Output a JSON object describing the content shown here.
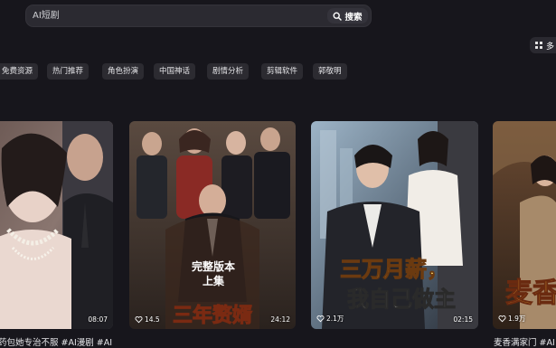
{
  "search": {
    "value": "AI短剧",
    "button_label": "搜索"
  },
  "top_right": {
    "label": "多"
  },
  "tags": [
    "免费资源",
    "热门推荐",
    "角色扮演",
    "中国神话",
    "剧情分析",
    "剪辑软件",
    "郭敬明"
  ],
  "cards": [
    {
      "duration": "08:07",
      "likes": "",
      "caption": "药包她专治不服 #AI漫剧 #AI",
      "overlay_title": ""
    },
    {
      "duration": "24:12",
      "likes": "14.5",
      "caption": "",
      "overlay_badge": "完整版本\n上集",
      "overlay_title": "三年赘婿"
    },
    {
      "duration": "02:15",
      "likes": "2.1万",
      "caption": "",
      "overlay_title": "三万月薪，\n我自己做主"
    },
    {
      "duration": "",
      "likes": "1.9万",
      "caption": "麦香满家门 #AI",
      "overlay_title": "麦香"
    }
  ],
  "colors": {
    "background": "#17161c",
    "surface": "#2b2a31",
    "tag_bg": "#2c2b31",
    "title_gold": "#f2c640"
  }
}
